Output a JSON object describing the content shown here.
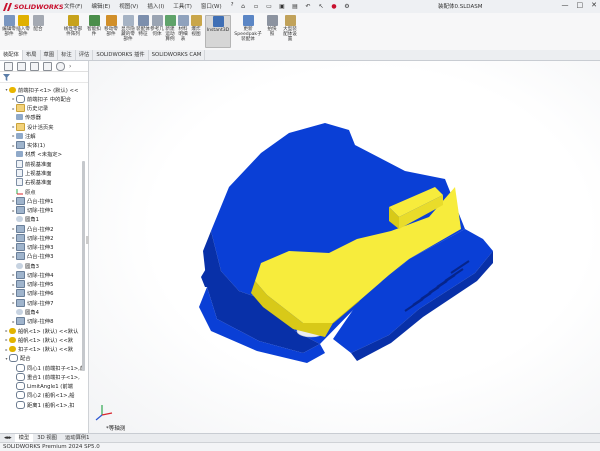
{
  "app": {
    "logo_text": "SOLIDWORKS",
    "menus": [
      "文件(F)",
      "编辑(E)",
      "视图(V)",
      "插入(I)",
      "工具(T)",
      "窗口(W)",
      "?"
    ],
    "doc_title": "装配体0.SLDASM",
    "window_controls": [
      "—",
      "□",
      "✕"
    ]
  },
  "ribbon": {
    "buttons": [
      {
        "label": "编辑零部件",
        "icon": "edit-component-icon",
        "color": "#7a96c0"
      },
      {
        "label": "插入零部件",
        "icon": "insert-component-icon",
        "color": "#e0b000"
      },
      {
        "label": "配合",
        "icon": "mate-icon",
        "color": "#a4a9b2"
      },
      {
        "label": "线性零部件阵列",
        "icon": "linear-pattern-icon",
        "color": "#c7a21b"
      },
      {
        "label": "智能扣件",
        "icon": "smart-fasteners-icon",
        "color": "#4b8e4b"
      },
      {
        "label": "移动零部件",
        "icon": "move-component-icon",
        "color": "#d18f2a"
      },
      {
        "label": "显示隐藏的零部件",
        "icon": "show-hidden-icon",
        "color": "#a6b3c4"
      },
      {
        "label": "装配体特征",
        "icon": "assembly-features-icon",
        "color": "#7c8fad"
      },
      {
        "label": "参考几何体",
        "icon": "reference-geometry-icon",
        "color": "#9aa4b3"
      },
      {
        "label": "新建运动算例",
        "icon": "new-motion-study-icon",
        "color": "#5fa36a"
      },
      {
        "label": "材料明细表",
        "icon": "bom-icon",
        "color": "#8fa2bd"
      },
      {
        "label": "爆炸视图",
        "icon": "exploded-view-icon",
        "color": "#c9a64a"
      },
      {
        "label": "Instant3D",
        "icon": "instant3d-icon",
        "color": "#3f6fb5"
      },
      {
        "label": "更新Speedpak子装配体",
        "icon": "speedpak-icon",
        "color": "#5b86c5"
      },
      {
        "label": "拍快照",
        "icon": "snapshot-icon",
        "color": "#8c93a0"
      },
      {
        "label": "大型装配体设置",
        "icon": "large-assembly-icon",
        "color": "#c1a25a"
      }
    ]
  },
  "cm_tabs": [
    "装配体",
    "布局",
    "草图",
    "标注",
    "评估",
    "SOLIDWORKS 插件",
    "SOLIDWORKS CAM"
  ],
  "tree": {
    "filter_icon": "filter-icon",
    "rows": [
      {
        "text": "前端扣子<1> (默认) <<",
        "icon": "ic-part",
        "expander": "▾",
        "level": 0
      },
      {
        "text": "前端扣子 中的配合",
        "icon": "ic-mate",
        "expander": "▸",
        "level": 1
      },
      {
        "text": "历史记录",
        "icon": "ic-folder",
        "expander": "▸",
        "level": 1
      },
      {
        "text": "传感器",
        "icon": "ic-note",
        "expander": "",
        "level": 1
      },
      {
        "text": "设计活页夹",
        "icon": "ic-folder",
        "expander": "▸",
        "level": 1
      },
      {
        "text": "注解",
        "icon": "ic-note",
        "expander": "▸",
        "level": 1
      },
      {
        "text": "实体(1)",
        "icon": "ic-feat",
        "expander": "▸",
        "level": 1
      },
      {
        "text": "材质 <未指定>",
        "icon": "ic-note",
        "expander": "",
        "level": 1
      },
      {
        "text": "前视基准面",
        "icon": "ic-plane",
        "expander": "",
        "level": 1
      },
      {
        "text": "上视基准面",
        "icon": "ic-plane",
        "expander": "",
        "level": 1
      },
      {
        "text": "右视基准面",
        "icon": "ic-plane",
        "expander": "",
        "level": 1
      },
      {
        "text": "原点",
        "icon": "ic-origin",
        "expander": "",
        "level": 1
      },
      {
        "text": "凸台-拉伸1",
        "icon": "ic-feat",
        "expander": "▸",
        "level": 1
      },
      {
        "text": "切除-拉伸1",
        "icon": "ic-feat",
        "expander": "▸",
        "level": 1
      },
      {
        "text": "圆角1",
        "icon": "ic-fillet",
        "expander": "",
        "level": 1
      },
      {
        "text": "凸台-拉伸2",
        "icon": "ic-feat",
        "expander": "▸",
        "level": 1
      },
      {
        "text": "切除-拉伸2",
        "icon": "ic-feat",
        "expander": "▸",
        "level": 1
      },
      {
        "text": "切除-拉伸3",
        "icon": "ic-feat",
        "expander": "▸",
        "level": 1
      },
      {
        "text": "凸台-拉伸3",
        "icon": "ic-feat",
        "expander": "▸",
        "level": 1
      },
      {
        "text": "圆角3",
        "icon": "ic-fillet",
        "expander": "",
        "level": 1
      },
      {
        "text": "切除-拉伸4",
        "icon": "ic-feat",
        "expander": "▸",
        "level": 1
      },
      {
        "text": "切除-拉伸5",
        "icon": "ic-feat",
        "expander": "▸",
        "level": 1
      },
      {
        "text": "切除-拉伸6",
        "icon": "ic-feat",
        "expander": "▸",
        "level": 1
      },
      {
        "text": "切除-拉伸7",
        "icon": "ic-feat",
        "expander": "▸",
        "level": 1
      },
      {
        "text": "圆角4",
        "icon": "ic-fillet",
        "expander": "",
        "level": 1
      },
      {
        "text": "切除-拉伸8",
        "icon": "ic-feat",
        "expander": "▸",
        "level": 1
      },
      {
        "text": "船帆<1> (默认) <<默认",
        "icon": "ic-sub",
        "expander": "▸",
        "level": 0
      },
      {
        "text": "船帆<1> (默认) <<默",
        "icon": "ic-sub",
        "expander": "▸",
        "level": 0
      },
      {
        "text": "扣子<1> (默认) <<默",
        "icon": "ic-sub",
        "expander": "▸",
        "level": 0
      },
      {
        "text": "配合",
        "icon": "ic-mate",
        "expander": "▾",
        "level": 0
      },
      {
        "text": "同心1 (前端扣子<1>,前",
        "icon": "ic-mate",
        "expander": "",
        "level": 1
      },
      {
        "text": "重合1 (前端扣子<1>,",
        "icon": "ic-mate",
        "expander": "",
        "level": 1
      },
      {
        "text": "LimitAngle1 (前端",
        "icon": "ic-mate",
        "expander": "",
        "level": 1
      },
      {
        "text": "同心2 (船帆<1>,船",
        "icon": "ic-mate",
        "expander": "",
        "level": 1
      },
      {
        "text": "距离1 (船帆<1>,扣",
        "icon": "ic-mate",
        "expander": "",
        "level": 1
      }
    ]
  },
  "viewport": {
    "view_label": "*等轴测",
    "colors": {
      "blue": "#0a3fd6",
      "blue_dark": "#0830a8",
      "yellow": "#f7ec3c",
      "yellow_dark": "#d8c918"
    }
  },
  "bottom_tabs": [
    "模型",
    "3D 视图",
    "运动算例1"
  ],
  "status": {
    "text": "SOLIDWORKS Premium 2024 SP5.0"
  }
}
